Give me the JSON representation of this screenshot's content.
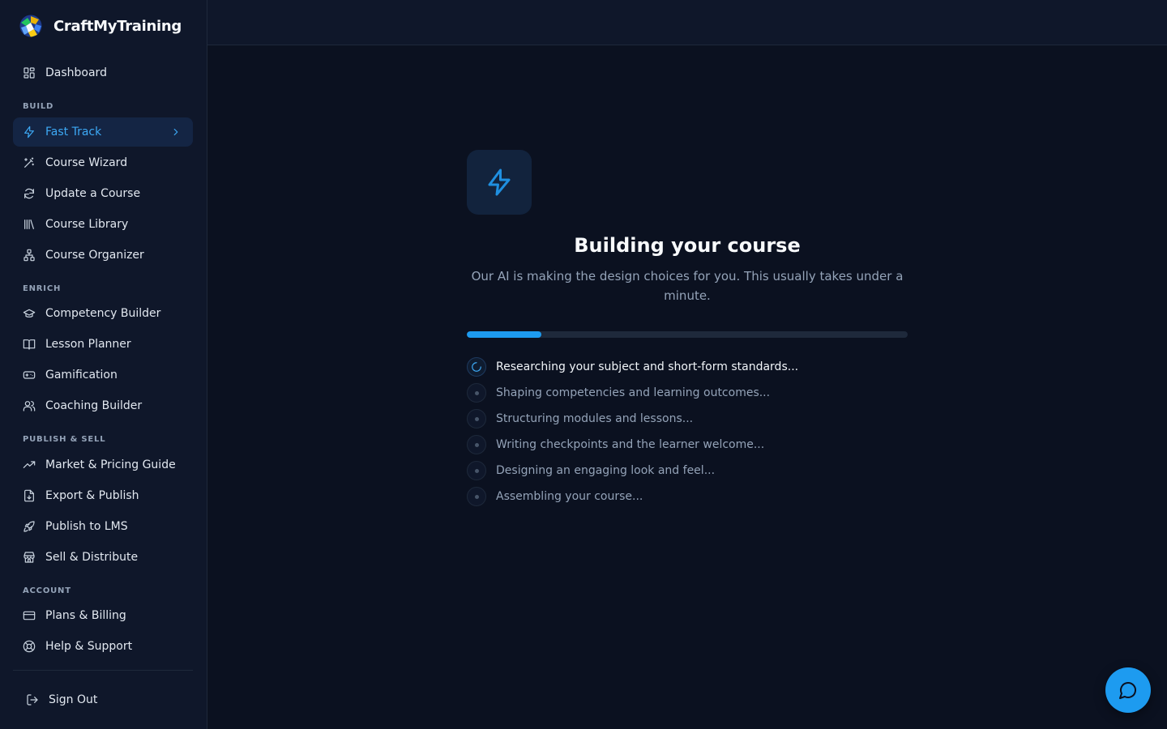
{
  "brand": {
    "name": "CraftMyTraining",
    "logo_icon": "globe-logo-icon"
  },
  "sidebar": {
    "dashboard": {
      "label": "Dashboard",
      "icon": "dashboard-grid-icon"
    },
    "sections": {
      "build": "BUILD",
      "enrich": "ENRICH",
      "publish": "PUBLISH & SELL",
      "account": "ACCOUNT"
    },
    "build_items": [
      {
        "label": "Fast Track",
        "icon": "lightning-icon",
        "active": true
      },
      {
        "label": "Course Wizard",
        "icon": "magic-wand-icon"
      },
      {
        "label": "Update a Course",
        "icon": "refresh-icon"
      },
      {
        "label": "Course Library",
        "icon": "library-icon"
      },
      {
        "label": "Course Organizer",
        "icon": "organizer-icon"
      }
    ],
    "enrich_items": [
      {
        "label": "Competency Builder",
        "icon": "graduation-cap-icon"
      },
      {
        "label": "Lesson Planner",
        "icon": "book-open-icon"
      },
      {
        "label": "Gamification",
        "icon": "gamepad-icon"
      },
      {
        "label": "Coaching Builder",
        "icon": "users-icon"
      }
    ],
    "publish_items": [
      {
        "label": "Market & Pricing Guide",
        "icon": "trending-up-icon"
      },
      {
        "label": "Export & Publish",
        "icon": "file-export-icon"
      },
      {
        "label": "Publish to LMS",
        "icon": "rocket-icon"
      },
      {
        "label": "Sell & Distribute",
        "icon": "store-icon"
      }
    ],
    "account_items": [
      {
        "label": "Plans & Billing",
        "icon": "credit-card-icon"
      },
      {
        "label": "Help & Support",
        "icon": "lifebuoy-icon"
      }
    ],
    "sign_out": {
      "label": "Sign Out",
      "icon": "log-out-icon"
    }
  },
  "main": {
    "hero_icon": "lightning-icon",
    "title": "Building your course",
    "subtitle": "Our AI is making the design choices for you. This usually takes under a minute.",
    "progress": 0.17,
    "steps": [
      {
        "label": "Researching your subject and short-form standards...",
        "state": "in-progress"
      },
      {
        "label": "Shaping competencies and learning outcomes...",
        "state": "pending"
      },
      {
        "label": "Structuring modules and lessons...",
        "state": "pending"
      },
      {
        "label": "Writing checkpoints and the learner welcome...",
        "state": "pending"
      },
      {
        "label": "Designing an engaging look and feel...",
        "state": "pending"
      },
      {
        "label": "Assembling your course...",
        "state": "pending"
      }
    ]
  },
  "chat_button": {
    "icon": "chat-bubble-icon"
  },
  "colors": {
    "accent": "#1d9bf0",
    "background": "#0b1120",
    "sidebar": "#0f172a"
  }
}
